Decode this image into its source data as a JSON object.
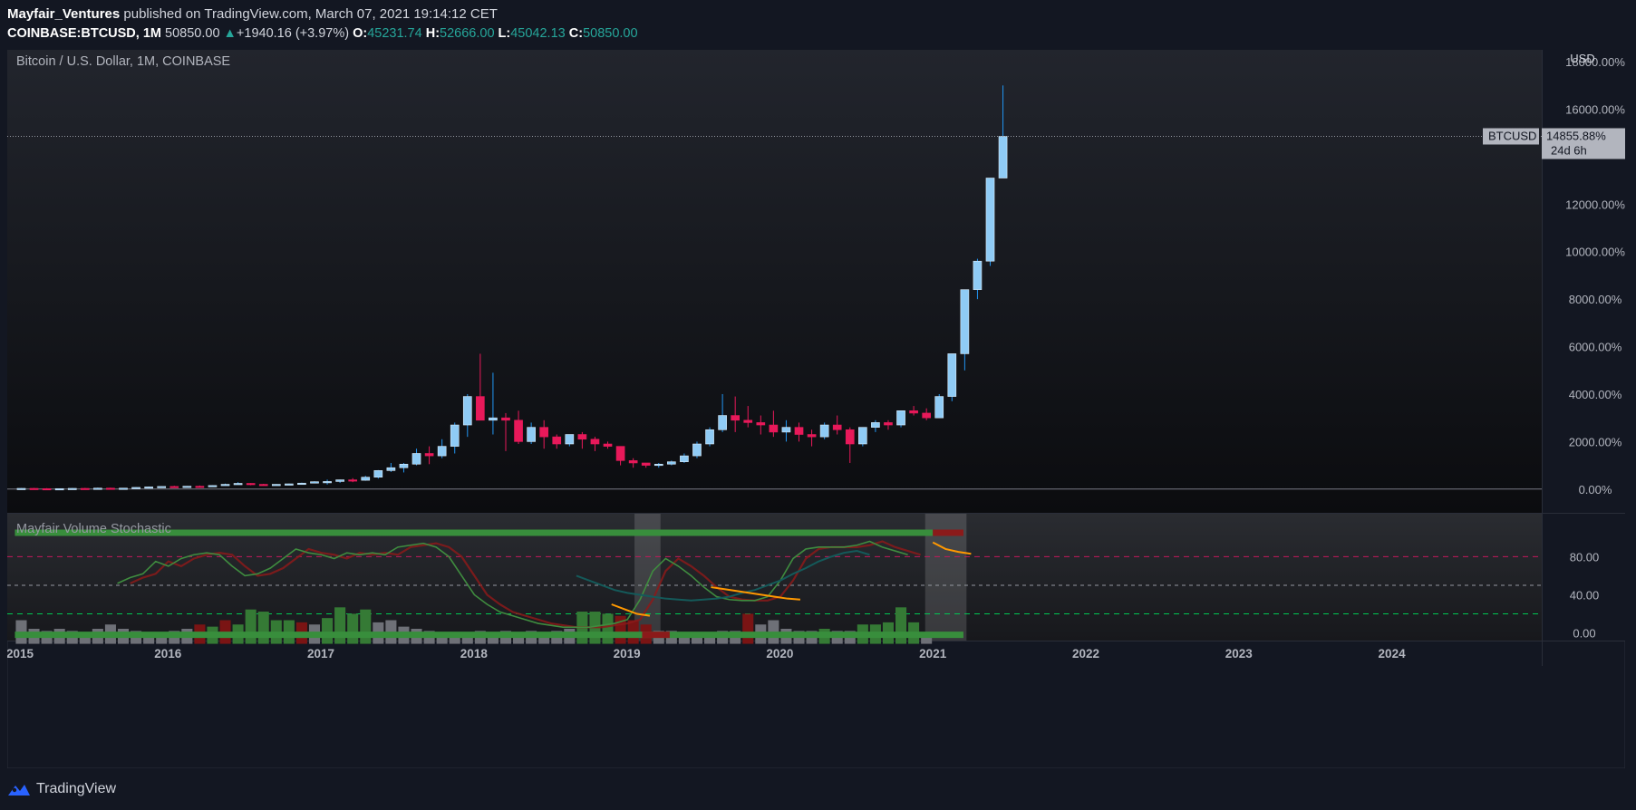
{
  "header": {
    "user": "Mayfair_Ventures",
    "published_text": " published on TradingView.com, March 07, 2021 19:14:12 CET",
    "symbol": "COINBASE:BTCUSD",
    "interval": "1M",
    "last": "50850.00",
    "change_arrow": "▲",
    "change": "+1940.16 (+3.97%)",
    "open_label": "O:",
    "open": "45231.74",
    "high_label": "H:",
    "high": "52666.00",
    "low_label": "L:",
    "low": "45042.13",
    "close_label": "C:",
    "close": "50850.00"
  },
  "chart_title": "Bitcoin / U.S. Dollar, 1M, COINBASE",
  "currency": "USD",
  "price_badge": {
    "symbol": "BTCUSD",
    "value": "14855.88%",
    "countdown": "24d 6h"
  },
  "indicator_title": "Mayfair Volume Stochastic",
  "footer": {
    "brand": "TradingView"
  },
  "colors": {
    "background": "#131722",
    "up": "#8fcbf5",
    "down": "#e8195a",
    "vol_green": "#357a35",
    "vol_red": "#7a1414",
    "vol_gray": "#6e7077",
    "band_green": "#388e3c",
    "stoch_green": "#3f8c3f",
    "stoch_red": "#8b1a1a",
    "stoch_teal": "#145a5a",
    "stoch_orange": "#ff9800",
    "level_red": "#c2185b",
    "level_green": "#00c853"
  },
  "chart_data": [
    {
      "type": "candlestick",
      "title": "Bitcoin / U.S. Dollar, 1M, COINBASE",
      "scale": "percent",
      "ylim": [
        -1000,
        18500
      ],
      "y_ticks": [
        "18000.00%",
        "16000.00%",
        "12000.00%",
        "10000.00%",
        "8000.00%",
        "6000.00%",
        "4000.00%",
        "2000.00%",
        "0.00%"
      ],
      "y_tick_values": [
        18000,
        16000,
        12000,
        10000,
        8000,
        6000,
        4000,
        2000,
        0
      ],
      "x_ticks": [
        "2015",
        "2016",
        "2017",
        "2018",
        "2019",
        "2020",
        "2021",
        "2022",
        "2023",
        "2024"
      ],
      "x_tick_years": [
        2015,
        2016,
        2017,
        2018,
        2019,
        2020,
        2021,
        2022,
        2023,
        2024
      ],
      "xlim": [
        2014.95,
        2024.98
      ],
      "start": 2015.0,
      "last_value": 14855.88,
      "candles": [
        {
          "o": 0,
          "h": 40,
          "l": -20,
          "c": 30
        },
        {
          "o": 30,
          "h": 50,
          "l": 0,
          "c": 20
        },
        {
          "o": 20,
          "h": 40,
          "l": 0,
          "c": 10
        },
        {
          "o": 10,
          "h": 30,
          "l": -10,
          "c": 20
        },
        {
          "o": 20,
          "h": 40,
          "l": 0,
          "c": 30
        },
        {
          "o": 30,
          "h": 50,
          "l": 10,
          "c": 20
        },
        {
          "o": 20,
          "h": 60,
          "l": 10,
          "c": 40
        },
        {
          "o": 40,
          "h": 60,
          "l": 20,
          "c": 30
        },
        {
          "o": 30,
          "h": 50,
          "l": 10,
          "c": 40
        },
        {
          "o": 40,
          "h": 80,
          "l": 30,
          "c": 70
        },
        {
          "o": 70,
          "h": 110,
          "l": 50,
          "c": 90
        },
        {
          "o": 90,
          "h": 120,
          "l": 70,
          "c": 110
        },
        {
          "o": 110,
          "h": 140,
          "l": 80,
          "c": 100
        },
        {
          "o": 100,
          "h": 130,
          "l": 80,
          "c": 120
        },
        {
          "o": 120,
          "h": 150,
          "l": 100,
          "c": 110
        },
        {
          "o": 110,
          "h": 160,
          "l": 100,
          "c": 150
        },
        {
          "o": 150,
          "h": 230,
          "l": 140,
          "c": 200
        },
        {
          "o": 200,
          "h": 290,
          "l": 190,
          "c": 240
        },
        {
          "o": 240,
          "h": 250,
          "l": 160,
          "c": 200
        },
        {
          "o": 200,
          "h": 220,
          "l": 160,
          "c": 190
        },
        {
          "o": 190,
          "h": 210,
          "l": 170,
          "c": 200
        },
        {
          "o": 200,
          "h": 230,
          "l": 190,
          "c": 220
        },
        {
          "o": 220,
          "h": 270,
          "l": 210,
          "c": 250
        },
        {
          "o": 250,
          "h": 330,
          "l": 240,
          "c": 310
        },
        {
          "o": 310,
          "h": 400,
          "l": 190,
          "c": 320
        },
        {
          "o": 320,
          "h": 400,
          "l": 260,
          "c": 390
        },
        {
          "o": 390,
          "h": 460,
          "l": 290,
          "c": 370
        },
        {
          "o": 370,
          "h": 560,
          "l": 350,
          "c": 500
        },
        {
          "o": 500,
          "h": 800,
          "l": 440,
          "c": 780
        },
        {
          "o": 780,
          "h": 1100,
          "l": 720,
          "c": 900
        },
        {
          "o": 900,
          "h": 1100,
          "l": 700,
          "c": 1050
        },
        {
          "o": 1050,
          "h": 1700,
          "l": 1000,
          "c": 1500
        },
        {
          "o": 1500,
          "h": 1800,
          "l": 1050,
          "c": 1400
        },
        {
          "o": 1400,
          "h": 2100,
          "l": 1300,
          "c": 1800
        },
        {
          "o": 1800,
          "h": 2800,
          "l": 1500,
          "c": 2700
        },
        {
          "o": 2700,
          "h": 4000,
          "l": 2200,
          "c": 3900
        },
        {
          "o": 3900,
          "h": 5700,
          "l": 3800,
          "c": 2900
        },
        {
          "o": 2900,
          "h": 4900,
          "l": 2300,
          "c": 3000
        },
        {
          "o": 3000,
          "h": 3200,
          "l": 1600,
          "c": 2900
        },
        {
          "o": 2900,
          "h": 3300,
          "l": 1900,
          "c": 2000
        },
        {
          "o": 2000,
          "h": 2800,
          "l": 1900,
          "c": 2600
        },
        {
          "o": 2600,
          "h": 2900,
          "l": 1700,
          "c": 2200
        },
        {
          "o": 2200,
          "h": 2300,
          "l": 1700,
          "c": 1900
        },
        {
          "o": 1900,
          "h": 2200,
          "l": 1800,
          "c": 2300
        },
        {
          "o": 2300,
          "h": 2400,
          "l": 1700,
          "c": 2100
        },
        {
          "o": 2100,
          "h": 2200,
          "l": 1600,
          "c": 1900
        },
        {
          "o": 1900,
          "h": 2000,
          "l": 1700,
          "c": 1800
        },
        {
          "o": 1800,
          "h": 1800,
          "l": 1000,
          "c": 1200
        },
        {
          "o": 1200,
          "h": 1300,
          "l": 900,
          "c": 1100
        },
        {
          "o": 1100,
          "h": 1100,
          "l": 900,
          "c": 1000
        },
        {
          "o": 1000,
          "h": 1100,
          "l": 900,
          "c": 1050
        },
        {
          "o": 1050,
          "h": 1200,
          "l": 1000,
          "c": 1150
        },
        {
          "o": 1150,
          "h": 1500,
          "l": 1100,
          "c": 1400
        },
        {
          "o": 1400,
          "h": 2000,
          "l": 1300,
          "c": 1900
        },
        {
          "o": 1900,
          "h": 2600,
          "l": 1800,
          "c": 2500
        },
        {
          "o": 2500,
          "h": 4000,
          "l": 2400,
          "c": 3100
        },
        {
          "o": 3100,
          "h": 3900,
          "l": 2400,
          "c": 2900
        },
        {
          "o": 2900,
          "h": 3500,
          "l": 2600,
          "c": 2800
        },
        {
          "o": 2800,
          "h": 3100,
          "l": 2300,
          "c": 2700
        },
        {
          "o": 2700,
          "h": 3300,
          "l": 2200,
          "c": 2400
        },
        {
          "o": 2400,
          "h": 2900,
          "l": 2000,
          "c": 2600
        },
        {
          "o": 2600,
          "h": 2800,
          "l": 2000,
          "c": 2300
        },
        {
          "o": 2300,
          "h": 2500,
          "l": 1800,
          "c": 2200
        },
        {
          "o": 2200,
          "h": 2800,
          "l": 2100,
          "c": 2700
        },
        {
          "o": 2700,
          "h": 3100,
          "l": 2300,
          "c": 2500
        },
        {
          "o": 2500,
          "h": 2600,
          "l": 1100,
          "c": 1900
        },
        {
          "o": 1900,
          "h": 2600,
          "l": 1800,
          "c": 2600
        },
        {
          "o": 2600,
          "h": 2900,
          "l": 2400,
          "c": 2800
        },
        {
          "o": 2800,
          "h": 2900,
          "l": 2500,
          "c": 2700
        },
        {
          "o": 2700,
          "h": 3300,
          "l": 2600,
          "c": 3300
        },
        {
          "o": 3300,
          "h": 3500,
          "l": 3100,
          "c": 3200
        },
        {
          "o": 3200,
          "h": 3400,
          "l": 2900,
          "c": 3000
        },
        {
          "o": 3000,
          "h": 4000,
          "l": 3000,
          "c": 3900
        },
        {
          "o": 3900,
          "h": 5700,
          "l": 3700,
          "c": 5700
        },
        {
          "o": 5700,
          "h": 8400,
          "l": 5000,
          "c": 8400
        },
        {
          "o": 8400,
          "h": 9700,
          "l": 8000,
          "c": 9600
        },
        {
          "o": 9600,
          "h": 12200,
          "l": 9400,
          "c": 13100
        },
        {
          "o": 13100,
          "h": 17000,
          "l": 13100,
          "c": 14856
        }
      ],
      "volume": [
        {
          "v": 0.55,
          "c": "gray"
        },
        {
          "v": 0.35,
          "c": "gray"
        },
        {
          "v": 0.3,
          "c": "gray"
        },
        {
          "v": 0.35,
          "c": "gray"
        },
        {
          "v": 0.3,
          "c": "gray"
        },
        {
          "v": 0.25,
          "c": "gray"
        },
        {
          "v": 0.35,
          "c": "gray"
        },
        {
          "v": 0.45,
          "c": "gray"
        },
        {
          "v": 0.35,
          "c": "gray"
        },
        {
          "v": 0.3,
          "c": "gray"
        },
        {
          "v": 0.25,
          "c": "gray"
        },
        {
          "v": 0.25,
          "c": "gray"
        },
        {
          "v": 0.3,
          "c": "gray"
        },
        {
          "v": 0.35,
          "c": "gray"
        },
        {
          "v": 0.45,
          "c": "red"
        },
        {
          "v": 0.4,
          "c": "green"
        },
        {
          "v": 0.55,
          "c": "red"
        },
        {
          "v": 0.45,
          "c": "green"
        },
        {
          "v": 0.8,
          "c": "green"
        },
        {
          "v": 0.75,
          "c": "green"
        },
        {
          "v": 0.55,
          "c": "green"
        },
        {
          "v": 0.55,
          "c": "green"
        },
        {
          "v": 0.5,
          "c": "red"
        },
        {
          "v": 0.45,
          "c": "gray"
        },
        {
          "v": 0.6,
          "c": "green"
        },
        {
          "v": 0.85,
          "c": "green"
        },
        {
          "v": 0.7,
          "c": "green"
        },
        {
          "v": 0.8,
          "c": "green"
        },
        {
          "v": 0.5,
          "c": "gray"
        },
        {
          "v": 0.55,
          "c": "gray"
        },
        {
          "v": 0.4,
          "c": "gray"
        },
        {
          "v": 0.35,
          "c": "gray"
        },
        {
          "v": 0.3,
          "c": "gray"
        },
        {
          "v": 0.25,
          "c": "gray"
        },
        {
          "v": 0.25,
          "c": "gray"
        },
        {
          "v": 0.25,
          "c": "gray"
        },
        {
          "v": 0.3,
          "c": "gray"
        },
        {
          "v": 0.25,
          "c": "gray"
        },
        {
          "v": 0.3,
          "c": "gray"
        },
        {
          "v": 0.25,
          "c": "gray"
        },
        {
          "v": 0.3,
          "c": "gray"
        },
        {
          "v": 0.25,
          "c": "gray"
        },
        {
          "v": 0.3,
          "c": "gray"
        },
        {
          "v": 0.35,
          "c": "gray"
        },
        {
          "v": 0.75,
          "c": "green"
        },
        {
          "v": 0.75,
          "c": "green"
        },
        {
          "v": 0.7,
          "c": "green"
        },
        {
          "v": 0.65,
          "c": "red"
        },
        {
          "v": 0.55,
          "c": "red"
        },
        {
          "v": 0.45,
          "c": "red"
        },
        {
          "v": 0.3,
          "c": "gray"
        },
        {
          "v": 0.3,
          "c": "gray"
        },
        {
          "v": 0.25,
          "c": "gray"
        },
        {
          "v": 0.25,
          "c": "gray"
        },
        {
          "v": 0.25,
          "c": "gray"
        },
        {
          "v": 0.3,
          "c": "gray"
        },
        {
          "v": 0.3,
          "c": "gray"
        },
        {
          "v": 0.7,
          "c": "red"
        },
        {
          "v": 0.45,
          "c": "gray"
        },
        {
          "v": 0.55,
          "c": "gray"
        },
        {
          "v": 0.35,
          "c": "gray"
        },
        {
          "v": 0.3,
          "c": "gray"
        },
        {
          "v": 0.3,
          "c": "gray"
        },
        {
          "v": 0.35,
          "c": "green"
        },
        {
          "v": 0.3,
          "c": "gray"
        },
        {
          "v": 0.3,
          "c": "gray"
        },
        {
          "v": 0.45,
          "c": "green"
        },
        {
          "v": 0.45,
          "c": "green"
        },
        {
          "v": 0.5,
          "c": "green"
        },
        {
          "v": 0.85,
          "c": "green"
        },
        {
          "v": 0.5,
          "c": "green"
        },
        {
          "v": 0.25,
          "c": "gray"
        }
      ]
    },
    {
      "type": "line",
      "title": "Mayfair Volume Stochastic",
      "ylim": [
        -8,
        125
      ],
      "y_ticks": [
        "80.00",
        "40.00",
        "0.00"
      ],
      "y_tick_values": [
        80,
        40,
        0
      ],
      "levels": [
        {
          "value": 80,
          "style": "dashed-red"
        },
        {
          "value": 50,
          "style": "dashed-gray"
        },
        {
          "value": 20,
          "style": "dashed-green"
        }
      ],
      "highlight_ranges": [
        [
          2019.05,
          2019.22
        ],
        [
          2020.95,
          2021.22
        ]
      ],
      "band_top": {
        "value": 105,
        "x_start": 2015.0,
        "x_end": 2021.2
      },
      "band_bottom": {
        "value": -2,
        "x_start": 2015.0,
        "x_end": 2021.2
      },
      "k_start": 2015.67,
      "k_values": [
        52,
        58,
        62,
        75,
        70,
        78,
        82,
        84,
        82,
        70,
        60,
        62,
        68,
        78,
        88,
        84,
        82,
        78,
        84,
        82,
        84,
        82,
        90,
        92,
        94,
        90,
        80,
        60,
        40,
        30,
        22,
        18,
        14,
        10,
        8,
        6,
        6,
        6,
        8,
        10,
        14,
        35,
        65,
        78,
        70,
        60,
        48,
        38,
        35,
        34,
        34,
        38,
        55,
        78,
        88,
        90,
        90,
        90,
        92,
        96,
        90,
        86,
        82
      ],
      "d_start": 2018.67,
      "d_values": [
        60,
        55,
        50,
        45,
        42,
        40,
        38,
        36,
        35,
        34,
        35,
        36,
        38,
        42,
        45,
        50,
        55,
        62,
        68,
        75,
        80,
        84,
        86,
        82
      ],
      "orange_segments": [
        {
          "x_start": 2018.9,
          "values": [
            30,
            25,
            20,
            18
          ]
        },
        {
          "x_start": 2019.55,
          "values": [
            48,
            46,
            44,
            42,
            40,
            38,
            36,
            35
          ]
        },
        {
          "x_start": 2021.0,
          "values": [
            95,
            88,
            85,
            83
          ]
        }
      ]
    }
  ]
}
